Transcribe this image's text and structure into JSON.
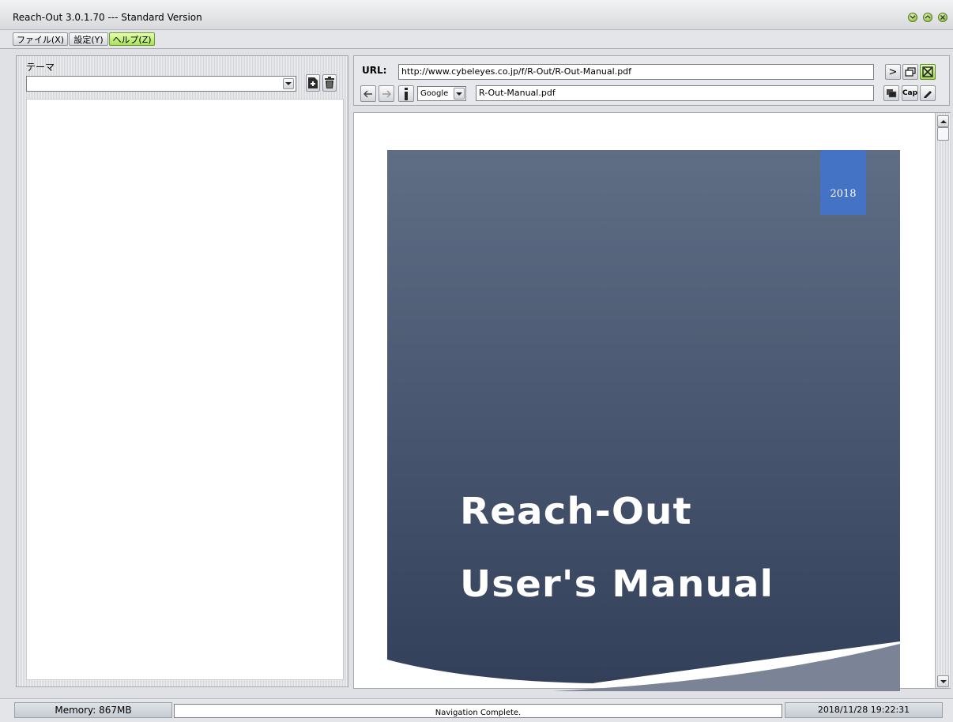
{
  "window": {
    "title": "Reach-Out 3.0.1.70 --- Standard Version"
  },
  "menu": {
    "items": [
      "ファイル(X)",
      "設定(Y)",
      "ヘルプ(Z)"
    ]
  },
  "sidebar": {
    "theme_label": "テーマ",
    "theme_value": ""
  },
  "toolbar": {
    "url_label": "URL:",
    "url_value": "http://www.cybeleyes.co.jp/f/R-Out/R-Out-Manual.pdf",
    "search_engine": "Google",
    "page_title_value": "R-Out-Manual.pdf",
    "go_label": ">",
    "cap_label": "Cap"
  },
  "document": {
    "year": "2018",
    "title_line1": "Reach-Out",
    "title_line2": "User's Manual",
    "colors": {
      "slate_top": "#5f6d85",
      "slate_bottom": "#33405a",
      "year_tab": "#4472c4"
    }
  },
  "status": {
    "memory": "Memory: 867MB",
    "message": "Navigation Complete.",
    "datetime": "2018/11/28 19:22:31"
  },
  "icons": [
    "minimize-icon",
    "restore-icon",
    "close-icon",
    "dropdown-arrow-icon",
    "add-theme-icon",
    "trash-icon",
    "back-arrow-icon",
    "forward-arrow-icon",
    "info-icon",
    "new-window-icon",
    "close-tab-icon",
    "copy-icon",
    "pen-icon",
    "scroll-up-icon",
    "scroll-down-icon"
  ]
}
